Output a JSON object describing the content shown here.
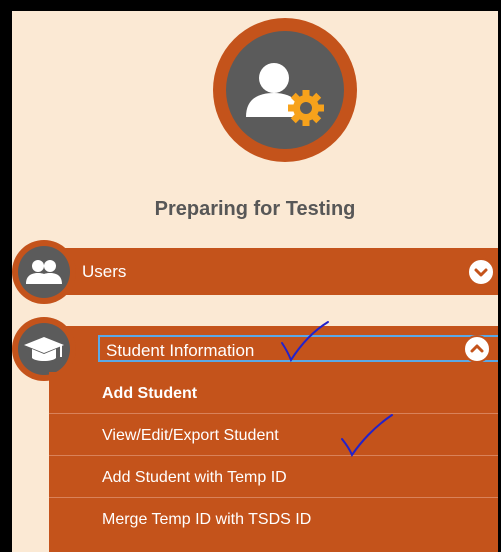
{
  "page": {
    "title": "Preparing for Testing"
  },
  "menu": {
    "users": {
      "label": "Users",
      "expanded": false
    },
    "student_information": {
      "label": "Student Information",
      "expanded": true,
      "items": [
        {
          "label": "Add Student"
        },
        {
          "label": "View/Edit/Export Student"
        },
        {
          "label": "Add Student with Temp ID"
        },
        {
          "label": "Merge Temp ID with TSDS ID"
        }
      ]
    }
  },
  "icons": {
    "hero": "user-gear-icon",
    "users": "users-icon",
    "student": "graduation-cap-icon",
    "expand": "chevron-down-icon",
    "collapse": "chevron-up-icon",
    "annotation": "checkmark-annotation"
  },
  "colors": {
    "accent": "#c4531b",
    "background": "#fbe9d4",
    "icon_gray": "#5b5b5b",
    "title_text": "#575757",
    "selection_border": "#5aa8e6",
    "annotation_ink": "#2222cc"
  }
}
